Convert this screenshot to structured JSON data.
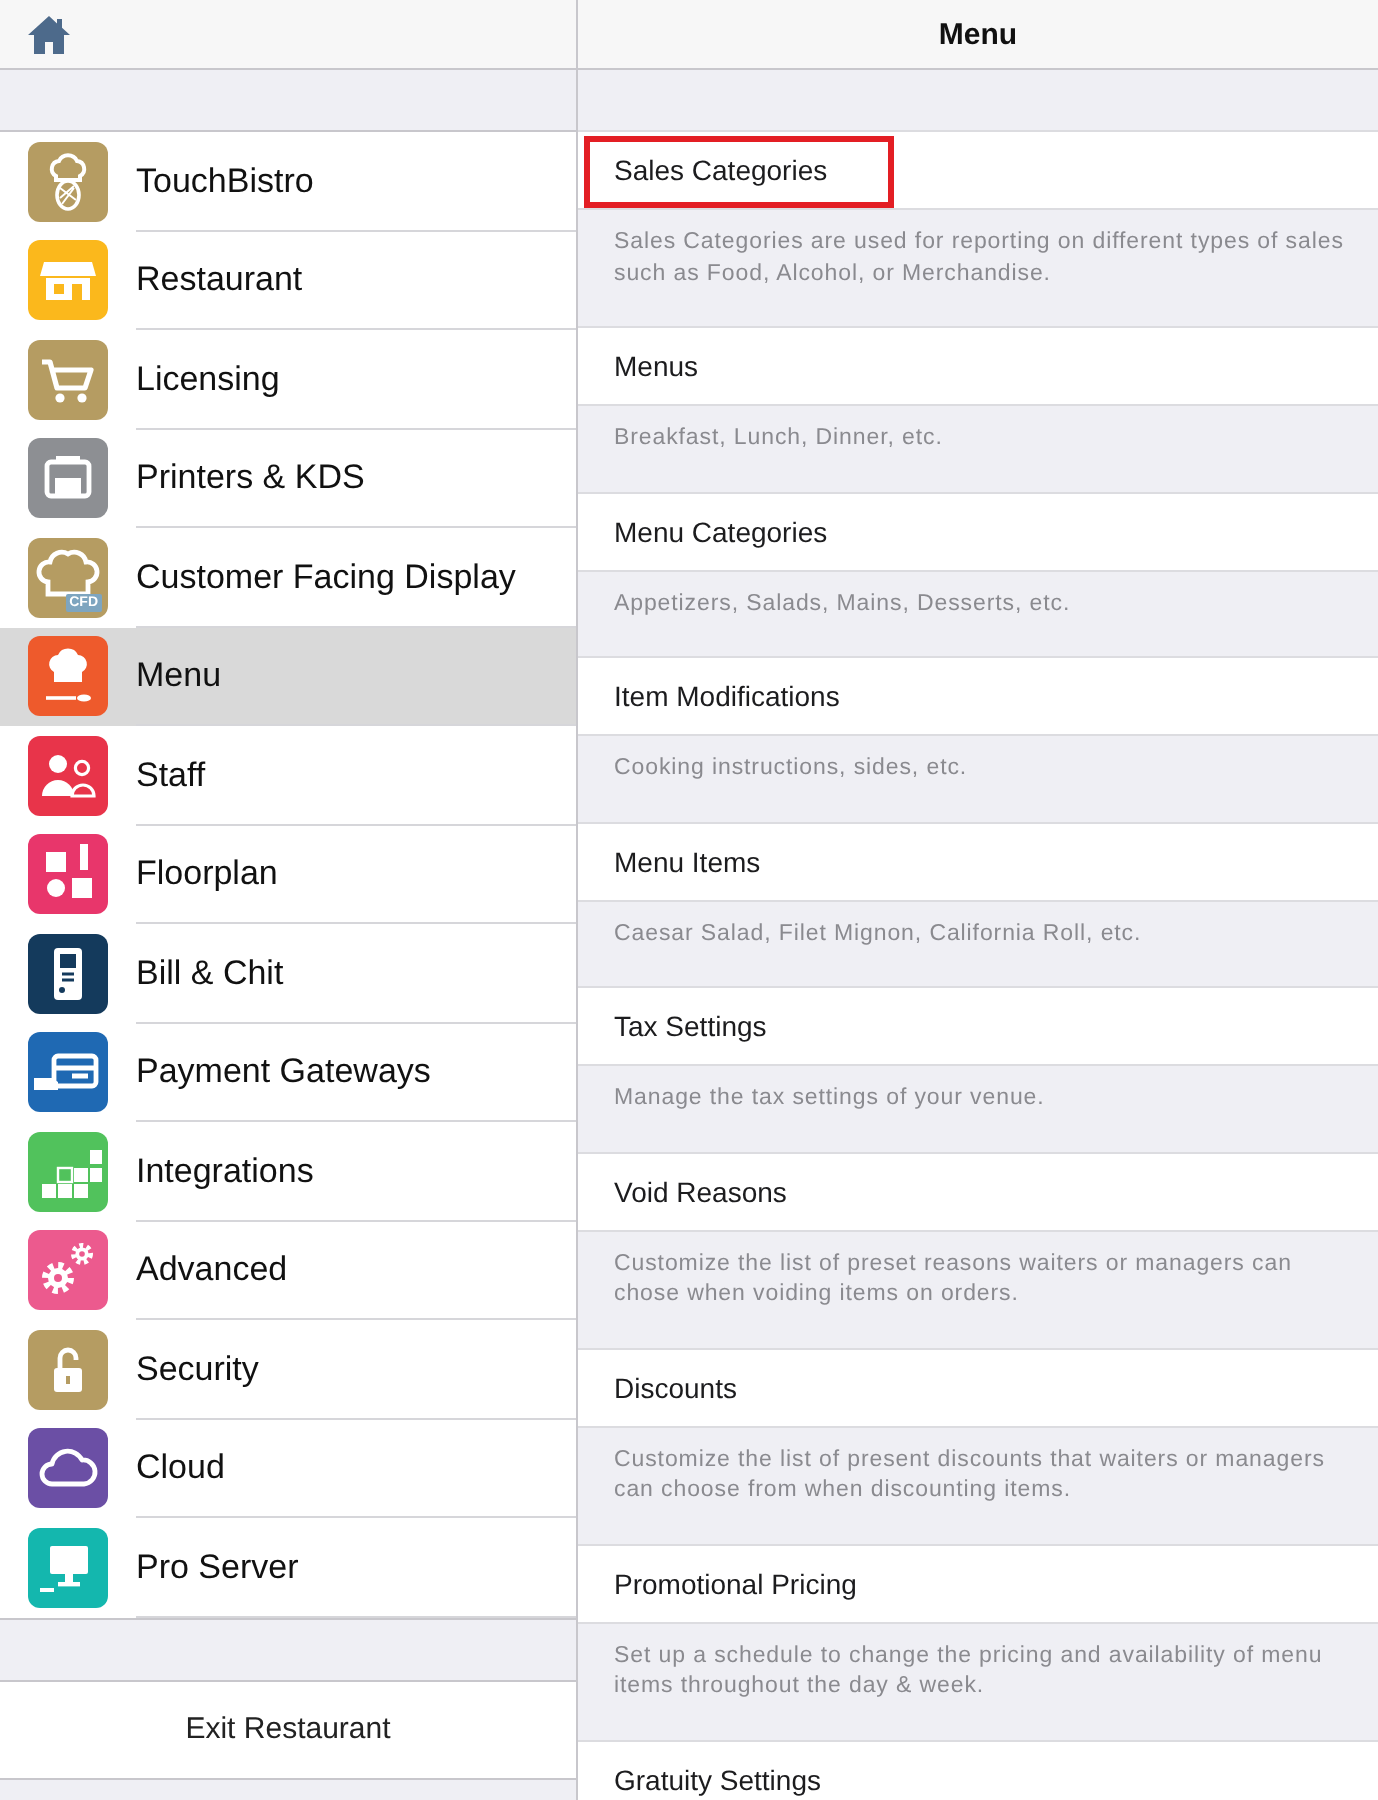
{
  "sidebar": {
    "items": [
      {
        "label": "TouchBistro",
        "selected": false
      },
      {
        "label": "Restaurant",
        "selected": false
      },
      {
        "label": "Licensing",
        "selected": false
      },
      {
        "label": "Printers & KDS",
        "selected": false
      },
      {
        "label": "Customer Facing Display",
        "selected": false,
        "badge": "CFD"
      },
      {
        "label": "Menu",
        "selected": true
      },
      {
        "label": "Staff",
        "selected": false
      },
      {
        "label": "Floorplan",
        "selected": false
      },
      {
        "label": "Bill & Chit",
        "selected": false
      },
      {
        "label": "Payment Gateways",
        "selected": false
      },
      {
        "label": "Integrations",
        "selected": false
      },
      {
        "label": "Advanced",
        "selected": false
      },
      {
        "label": "Security",
        "selected": false
      },
      {
        "label": "Cloud",
        "selected": false
      },
      {
        "label": "Pro Server",
        "selected": false
      }
    ],
    "exit_button": "Exit Restaurant"
  },
  "detail": {
    "title": "Menu",
    "items": [
      {
        "title": "Sales Categories",
        "description": "Sales Categories are used for reporting on different types of sales such as Food, Alcohol, or Merchandise.",
        "highlighted": true
      },
      {
        "title": "Menus",
        "description": "Breakfast, Lunch, Dinner, etc.",
        "highlighted": false
      },
      {
        "title": "Menu Categories",
        "description": "Appetizers, Salads, Mains, Desserts, etc.",
        "highlighted": false
      },
      {
        "title": "Item Modifications",
        "description": "Cooking instructions, sides, etc.",
        "highlighted": false
      },
      {
        "title": "Menu Items",
        "description": "Caesar Salad, Filet Mignon, California Roll, etc.",
        "highlighted": false
      },
      {
        "title": "Tax Settings",
        "description": "Manage the tax settings of your venue.",
        "highlighted": false
      },
      {
        "title": "Void Reasons",
        "description": "Customize the list of preset reasons waiters or managers can chose when voiding items on orders.",
        "highlighted": false
      },
      {
        "title": "Discounts",
        "description": "Customize the list of present discounts that waiters or managers can choose from when discounting items.",
        "highlighted": false
      },
      {
        "title": "Promotional Pricing",
        "description": "Set up a schedule to change the pricing and availability of menu items throughout the day & week.",
        "highlighted": false
      },
      {
        "title": "Gratuity Settings",
        "highlighted": false
      }
    ]
  }
}
